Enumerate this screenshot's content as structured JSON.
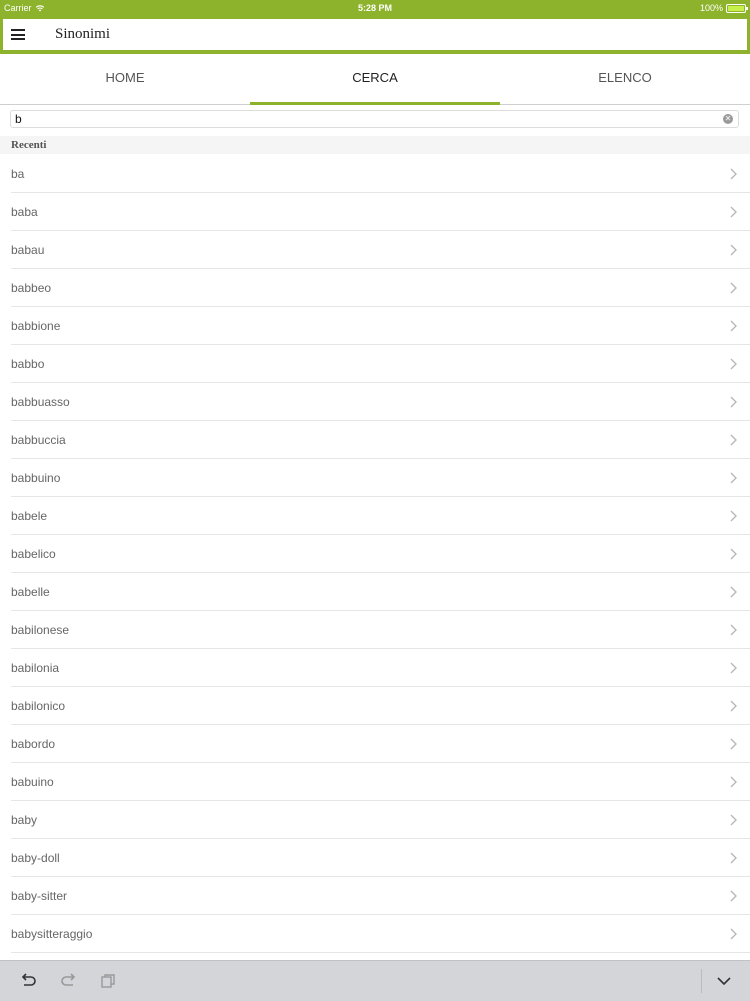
{
  "status_bar": {
    "carrier": "Carrier",
    "time": "5:28 PM",
    "battery": "100%"
  },
  "app": {
    "title": "Sinonimi"
  },
  "tabs": [
    {
      "label": "HOME",
      "active": false
    },
    {
      "label": "CERCA",
      "active": true
    },
    {
      "label": "ELENCO",
      "active": false
    }
  ],
  "search": {
    "value": "b"
  },
  "section": {
    "title": "Recenti"
  },
  "items": [
    "ba",
    "baba",
    "babau",
    "babbeo",
    "babbione",
    "babbo",
    "babbuasso",
    "babbuccia",
    "babbuino",
    "babele",
    "babelico",
    "babelle",
    "babilonese",
    "babilonia",
    "babilonico",
    "babordo",
    "babuino",
    "baby",
    "baby-doll",
    "baby-sitter",
    "babysitteraggio"
  ],
  "colors": {
    "accent": "#8db32c"
  },
  "toolbar": {
    "icons": [
      "undo-icon",
      "redo-icon",
      "paste-icon",
      "chevron-down-icon"
    ]
  }
}
